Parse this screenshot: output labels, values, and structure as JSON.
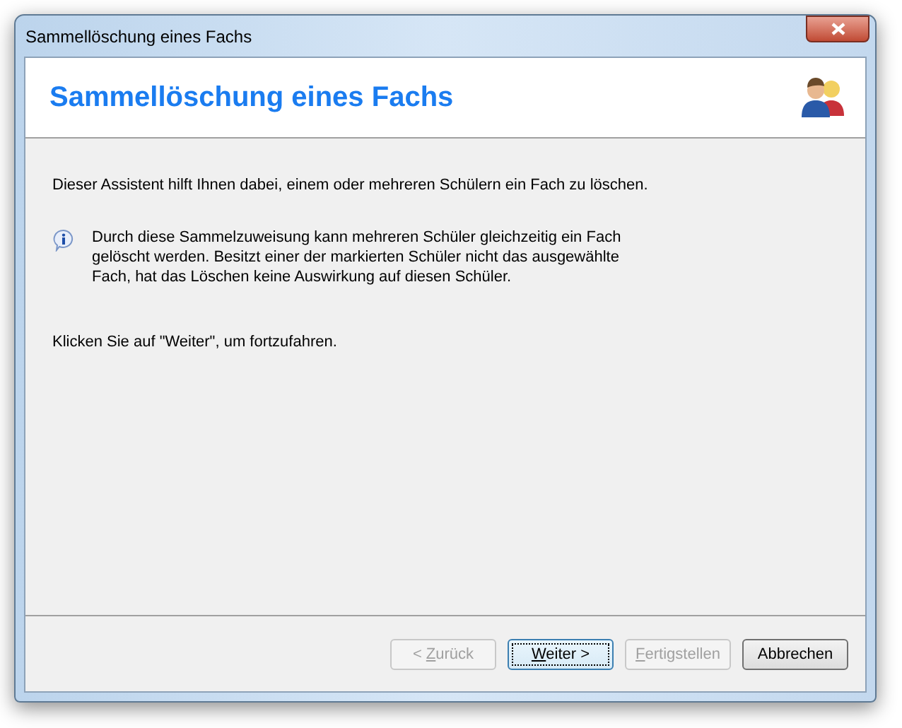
{
  "window": {
    "title": "Sammellöschung eines Fachs"
  },
  "header": {
    "title": "Sammellöschung eines Fachs"
  },
  "intro": "Dieser Assistent hilft Ihnen dabei, einem oder mehreren Schülern ein Fach zu löschen.",
  "info": "Durch diese Sammelzuweisung kann mehreren Schüler gleichzeitig ein Fach gelöscht werden. Besitzt einer der markierten Schüler nicht das ausgewählte Fach, hat das Löschen keine Auswirkung auf diesen Schüler.",
  "instruction": "Klicken Sie auf \"Weiter\", um fortzufahren.",
  "buttons": [
    {
      "pre": "< ",
      "key": "Z",
      "post": "urück",
      "disabled": true,
      "focused": false
    },
    {
      "key": "W",
      "post": "eiter >",
      "disabled": false,
      "focused": true
    },
    {
      "key": "F",
      "post": "ertigstellen",
      "disabled": true,
      "focused": false
    },
    {
      "pre": "Abbrechen",
      "disabled": false,
      "focused": false
    }
  ]
}
